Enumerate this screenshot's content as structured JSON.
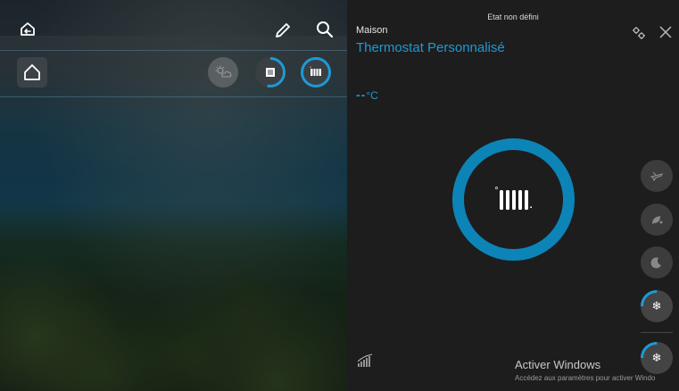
{
  "left_panel": {
    "icons": {
      "back": "back-home-icon",
      "edit": "pencil-icon",
      "search": "search-icon",
      "home": "home-icon",
      "sun_cloud": "sun-cloud-icon",
      "scenario": "scenario-icon",
      "heater_mode": "heater-mode-icon"
    }
  },
  "right_panel": {
    "state_label": "Etat non défini",
    "location": "Maison",
    "title": "Thermostat Personnalisé",
    "temperature": {
      "value": "--",
      "unit": "°C"
    },
    "ring_icon_label": "°",
    "ring_icon_suffix": ".",
    "accent_color": "#1d9ad6",
    "mode_buttons": [
      {
        "name": "away-mode",
        "icon": "plane-icon"
      },
      {
        "name": "eco-mode",
        "icon": "leaf-icon"
      },
      {
        "name": "night-mode",
        "icon": "moon-icon"
      },
      {
        "name": "frost-mode",
        "icon": "snowflake-icon",
        "progress": 0.25
      },
      {
        "name": "frost-mode-2",
        "icon": "snowflake-icon",
        "progress": 0.25
      }
    ],
    "watermark": {
      "line1": "Activer Windows",
      "line2": "Accédez aux paramètres pour activer Windo"
    }
  }
}
